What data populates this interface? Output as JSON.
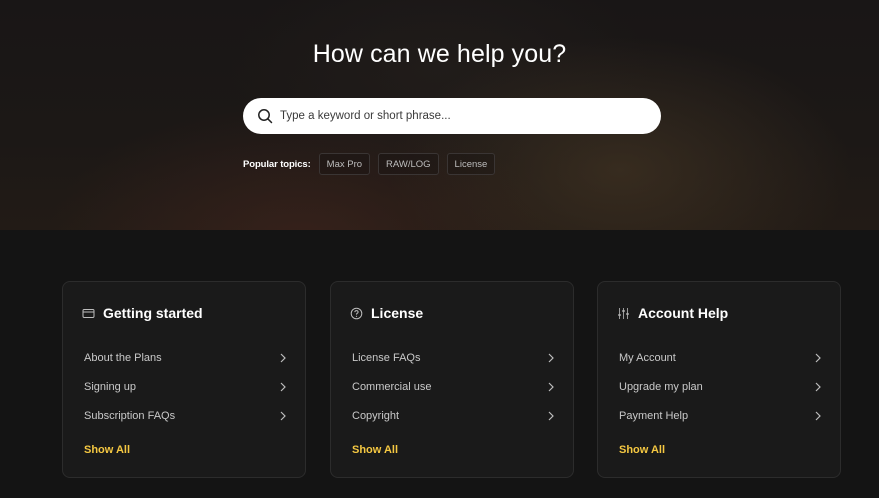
{
  "hero": {
    "title": "How can we help you?",
    "search_placeholder": "Type a keyword or short phrase...",
    "popular_label": "Popular topics:",
    "topics": [
      "Max Pro",
      "RAW/LOG",
      "License"
    ]
  },
  "cards": [
    {
      "title": "Getting started",
      "icon": "card-icon",
      "links": [
        "About the Plans",
        "Signing up",
        "Subscription FAQs"
      ],
      "show_all": "Show All"
    },
    {
      "title": "License",
      "icon": "question-circle-icon",
      "links": [
        "License FAQs",
        "Commercial use",
        "Copyright"
      ],
      "show_all": "Show All"
    },
    {
      "title": "Account Help",
      "icon": "sliders-icon",
      "links": [
        "My Account",
        "Upgrade my plan",
        "Payment Help"
      ],
      "show_all": "Show All"
    }
  ],
  "colors": {
    "accent": "#f5c842",
    "background": "#141414",
    "card_background": "#1a1a1a"
  }
}
